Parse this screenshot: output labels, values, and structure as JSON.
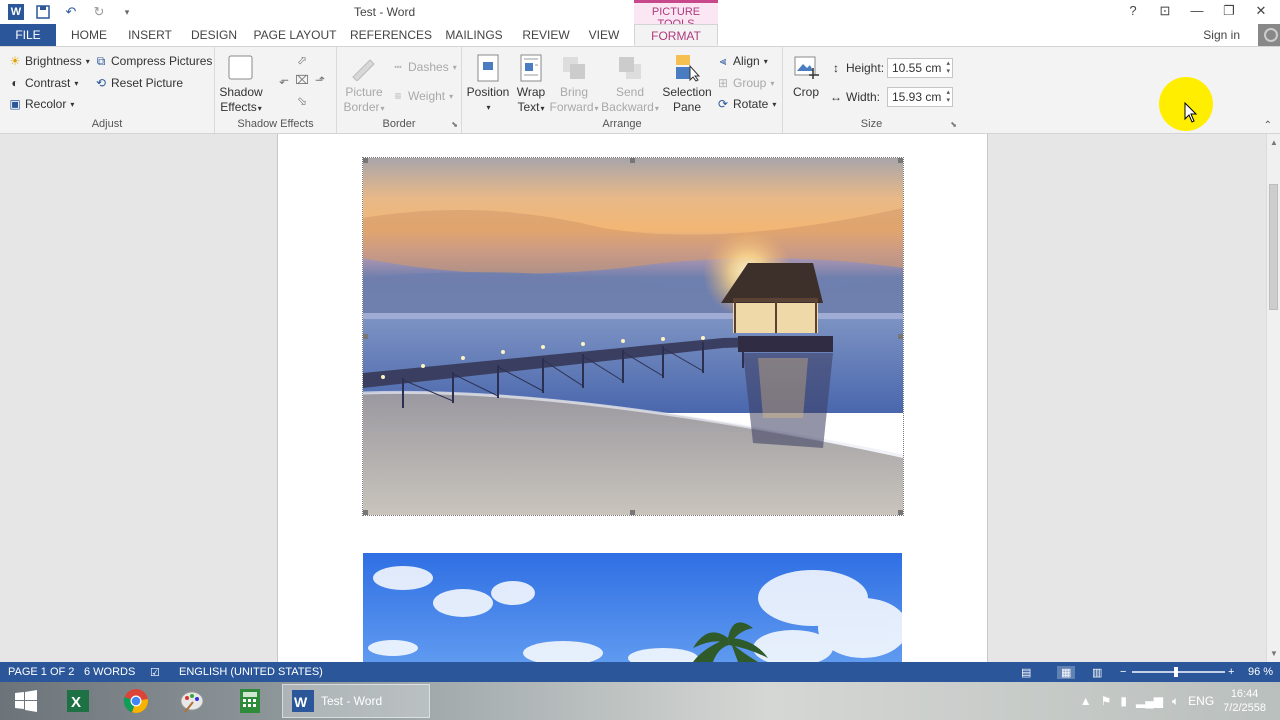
{
  "window": {
    "title": "Test - Word",
    "context_tab_group": "PICTURE TOOLS",
    "sign_in": "Sign in",
    "help": "?"
  },
  "tabs": [
    {
      "label": "FILE"
    },
    {
      "label": "HOME"
    },
    {
      "label": "INSERT"
    },
    {
      "label": "DESIGN"
    },
    {
      "label": "PAGE LAYOUT"
    },
    {
      "label": "REFERENCES"
    },
    {
      "label": "MAILINGS"
    },
    {
      "label": "REVIEW"
    },
    {
      "label": "VIEW"
    },
    {
      "label": "FORMAT"
    }
  ],
  "ribbon": {
    "adjust": {
      "label": "Adjust",
      "brightness": "Brightness",
      "contrast": "Contrast",
      "recolor": "Recolor",
      "compress": "Compress Pictures",
      "reset": "Reset Picture"
    },
    "shadow": {
      "label": "Shadow Effects",
      "button_line1": "Shadow",
      "button_line2": "Effects"
    },
    "border": {
      "label": "Border",
      "picture_border_line1": "Picture",
      "picture_border_line2": "Border",
      "dashes": "Dashes",
      "weight": "Weight"
    },
    "arrange": {
      "label": "Arrange",
      "position": "Position",
      "wrap_line1": "Wrap",
      "wrap_line2": "Text",
      "bring_line1": "Bring",
      "bring_line2": "Forward",
      "send_line1": "Send",
      "send_line2": "Backward",
      "selection_line1": "Selection",
      "selection_line2": "Pane",
      "align": "Align",
      "group": "Group",
      "rotate": "Rotate"
    },
    "size": {
      "label": "Size",
      "crop": "Crop",
      "height_label": "Height:",
      "height_value": "10.55 cm",
      "width_label": "Width:",
      "width_value": "15.93 cm"
    }
  },
  "statusbar": {
    "page": "PAGE 1 OF 2",
    "words": "6 WORDS",
    "language": "ENGLISH (UNITED STATES)",
    "zoom": "96 %",
    "zoom_level_percent": 96
  },
  "taskbar": {
    "word_item": "Test - Word",
    "lang": "ENG",
    "time": "16:44",
    "date": "7/2/2558"
  },
  "colors": {
    "word_blue": "#2b579a",
    "picture_tools_pink": "#b03a7e",
    "cursor_highlight": "#ffee00"
  }
}
